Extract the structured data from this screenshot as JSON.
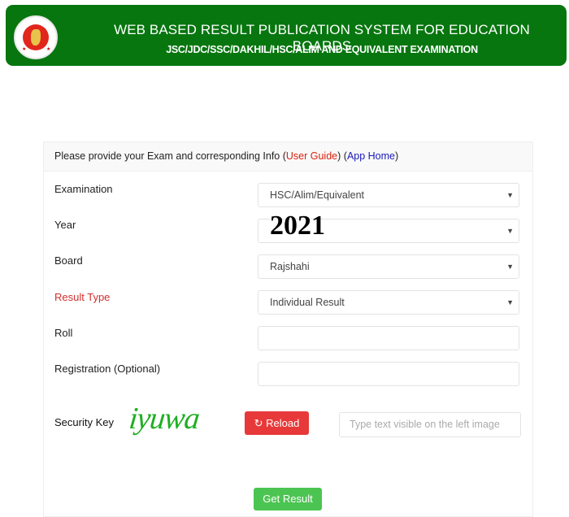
{
  "header": {
    "title": "WEB BASED RESULT PUBLICATION SYSTEM FOR EDUCATION BOARDS",
    "subtitle": "JSC/JDC/SSC/DAKHIL/HSC/ALIM AND EQUIVALENT EXAMINATION",
    "logo": "government-seal-icon"
  },
  "panel": {
    "intro_text": "Please provide your Exam and corresponding Info",
    "user_guide": "User Guide",
    "app_home": "App Home"
  },
  "form": {
    "examination": {
      "label": "Examination",
      "value": "HSC/Alim/Equivalent"
    },
    "year": {
      "label": "Year",
      "value": "2021"
    },
    "board": {
      "label": "Board",
      "value": "Rajshahi"
    },
    "result_type": {
      "label": "Result Type",
      "value": "Individual Result",
      "label_color": "#d32f2f"
    },
    "roll": {
      "label": "Roll",
      "value": ""
    },
    "registration": {
      "label": "Registration (Optional)",
      "value": ""
    },
    "security": {
      "label": "Security Key",
      "captcha_text": "iyuwa",
      "reload_label": "Reload",
      "reload_icon": "refresh-icon",
      "placeholder": "Type text visible on the left image"
    },
    "submit_label": "Get Result"
  },
  "colors": {
    "header_bg": "#07760f",
    "reload_bg": "#e8393a",
    "submit_bg": "#4cc452",
    "captcha": "#1fae23"
  }
}
